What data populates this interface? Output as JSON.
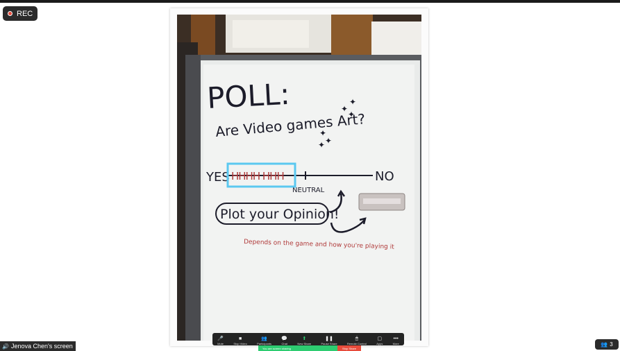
{
  "recording": {
    "label": "REC"
  },
  "whiteboard": {
    "title": "POLL:",
    "question": "Are Video games Art?",
    "scale_left": "YES",
    "scale_tally": "HHHH HHH",
    "scale_middle": "NEUTRAL",
    "scale_right": "NO",
    "prompt": "Plot your Opinion!",
    "comment": "Depends on the game and how you're playing it"
  },
  "toolbar": {
    "items": [
      {
        "label": "Mute",
        "icon": "microphone-icon",
        "glyph": "🎤"
      },
      {
        "label": "Stop Video",
        "icon": "video-camera-icon",
        "glyph": "■"
      },
      {
        "label": "Participants",
        "icon": "participants-icon",
        "glyph": "👥"
      },
      {
        "label": "Chat",
        "icon": "chat-icon",
        "glyph": "💬"
      },
      {
        "label": "New Share",
        "icon": "share-screen-icon",
        "glyph": "⬆"
      },
      {
        "label": "Pause Share",
        "icon": "pause-icon",
        "glyph": "❚❚"
      },
      {
        "label": "Remote Control",
        "icon": "remote-control-icon",
        "glyph": "🖱"
      },
      {
        "label": "Apps",
        "icon": "apps-icon",
        "glyph": "▢"
      },
      {
        "label": "More",
        "icon": "more-icon",
        "glyph": "•••"
      }
    ],
    "share_status": "You are screen sharing",
    "stop_share": "Stop Share"
  },
  "footer": {
    "screen_label": "Jenova Chen's screen",
    "participant_count": "3"
  },
  "colors": {
    "highlight": "#5bc8f0",
    "marker_black": "#1c1c2a",
    "marker_red": "#b03a3a",
    "accent_green": "#2ecc71",
    "accent_red": "#e74c3c"
  }
}
